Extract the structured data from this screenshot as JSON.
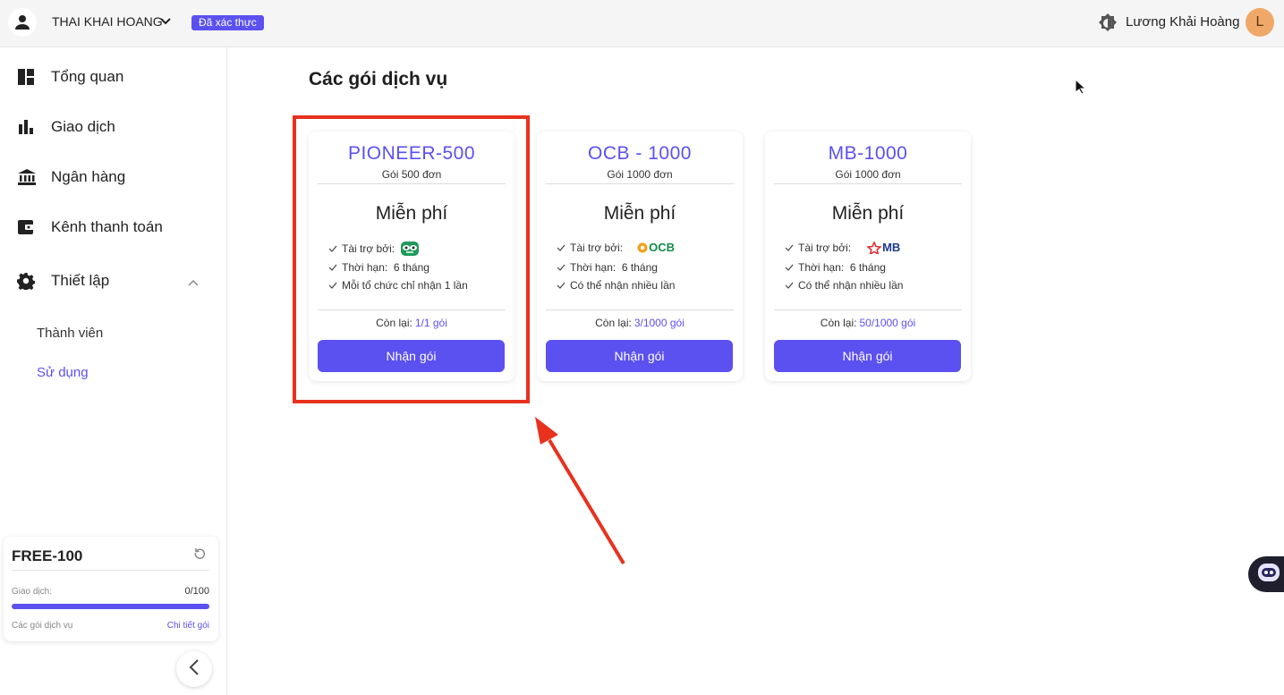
{
  "header": {
    "org_name": "THAI KHAI HOANG",
    "verified_label": "Đã xác thực",
    "account_name": "Lương Khải Hoàng",
    "account_initial": "L"
  },
  "sidebar": {
    "items": [
      {
        "label": "Tổng quan",
        "icon": "dashboard-icon"
      },
      {
        "label": "Giao dịch",
        "icon": "bar-chart-icon"
      },
      {
        "label": "Ngân hàng",
        "icon": "bank-icon"
      },
      {
        "label": "Kênh thanh toán",
        "icon": "wallet-icon"
      },
      {
        "label": "Thiết lập",
        "icon": "gear-icon"
      }
    ],
    "sub_items": [
      {
        "label": "Thành viên",
        "active": false
      },
      {
        "label": "Sử dụng",
        "active": true
      }
    ],
    "plan": {
      "name": "FREE-100",
      "usage_label": "Giao dịch:",
      "usage_value": "0/100",
      "usage_fraction": 1.0,
      "plans_link": "Các gói dịch vụ",
      "detail_link": "Chi tiết gói"
    }
  },
  "main": {
    "title": "Các gói dịch vụ",
    "cards": [
      {
        "title": "PIONEER-500",
        "subtitle": "Gói 500 đơn",
        "price": "Miễn phí",
        "features": [
          "Tài trợ bởi:",
          "Thời hạn:  6 tháng",
          "Mỗi tổ chức chỉ nhận 1 lần"
        ],
        "sponsor_logo": "pioneer-mascot-logo",
        "remaining_label": "Còn lại:",
        "remaining_value": "1/1 gói",
        "button": "Nhận gói"
      },
      {
        "title": "OCB - 1000",
        "subtitle": "Gói 1000 đơn",
        "price": "Miễn phí",
        "features": [
          "Tài trợ bởi:",
          "Thời hạn:  6 tháng",
          "Có thể nhận nhiều lần"
        ],
        "sponsor_logo": "ocb-logo",
        "sponsor_text": "OCB",
        "remaining_label": "Còn lại:",
        "remaining_value": "3/1000 gói",
        "button": "Nhận gói"
      },
      {
        "title": "MB-1000",
        "subtitle": "Gói 1000 đơn",
        "price": "Miễn phí",
        "features": [
          "Tài trợ bởi:",
          "Thời hạn:  6 tháng",
          "Có thể nhận nhiều lần"
        ],
        "sponsor_logo": "mb-logo",
        "sponsor_text": "MB",
        "remaining_label": "Còn lại:",
        "remaining_value": "50/1000 gói",
        "button": "Nhận gói"
      }
    ]
  },
  "colors": {
    "accent": "#5b50f0",
    "annotation": "#e8321e",
    "avatar": "#f0a868"
  }
}
